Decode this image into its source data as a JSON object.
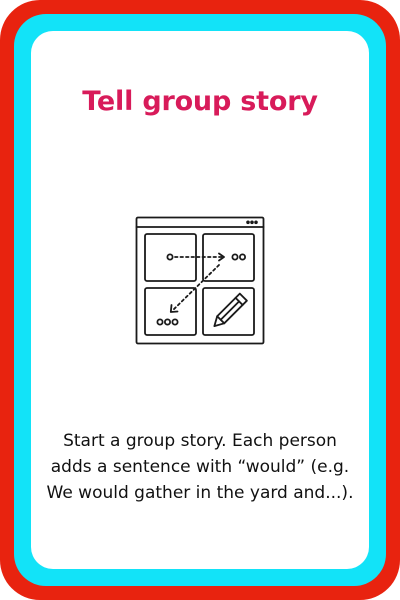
{
  "card": {
    "title": "Tell group story",
    "body": "Start a group story. Each person adds a sentence with “would” (e.g. We would gather in the yard and...).",
    "illustration_icon": "storyboard-icon",
    "colors": {
      "outer_border": "#e8230f",
      "inner_border": "#12e3f8",
      "background": "#ffffff",
      "title": "#d81b5a",
      "body_text": "#111111"
    }
  }
}
